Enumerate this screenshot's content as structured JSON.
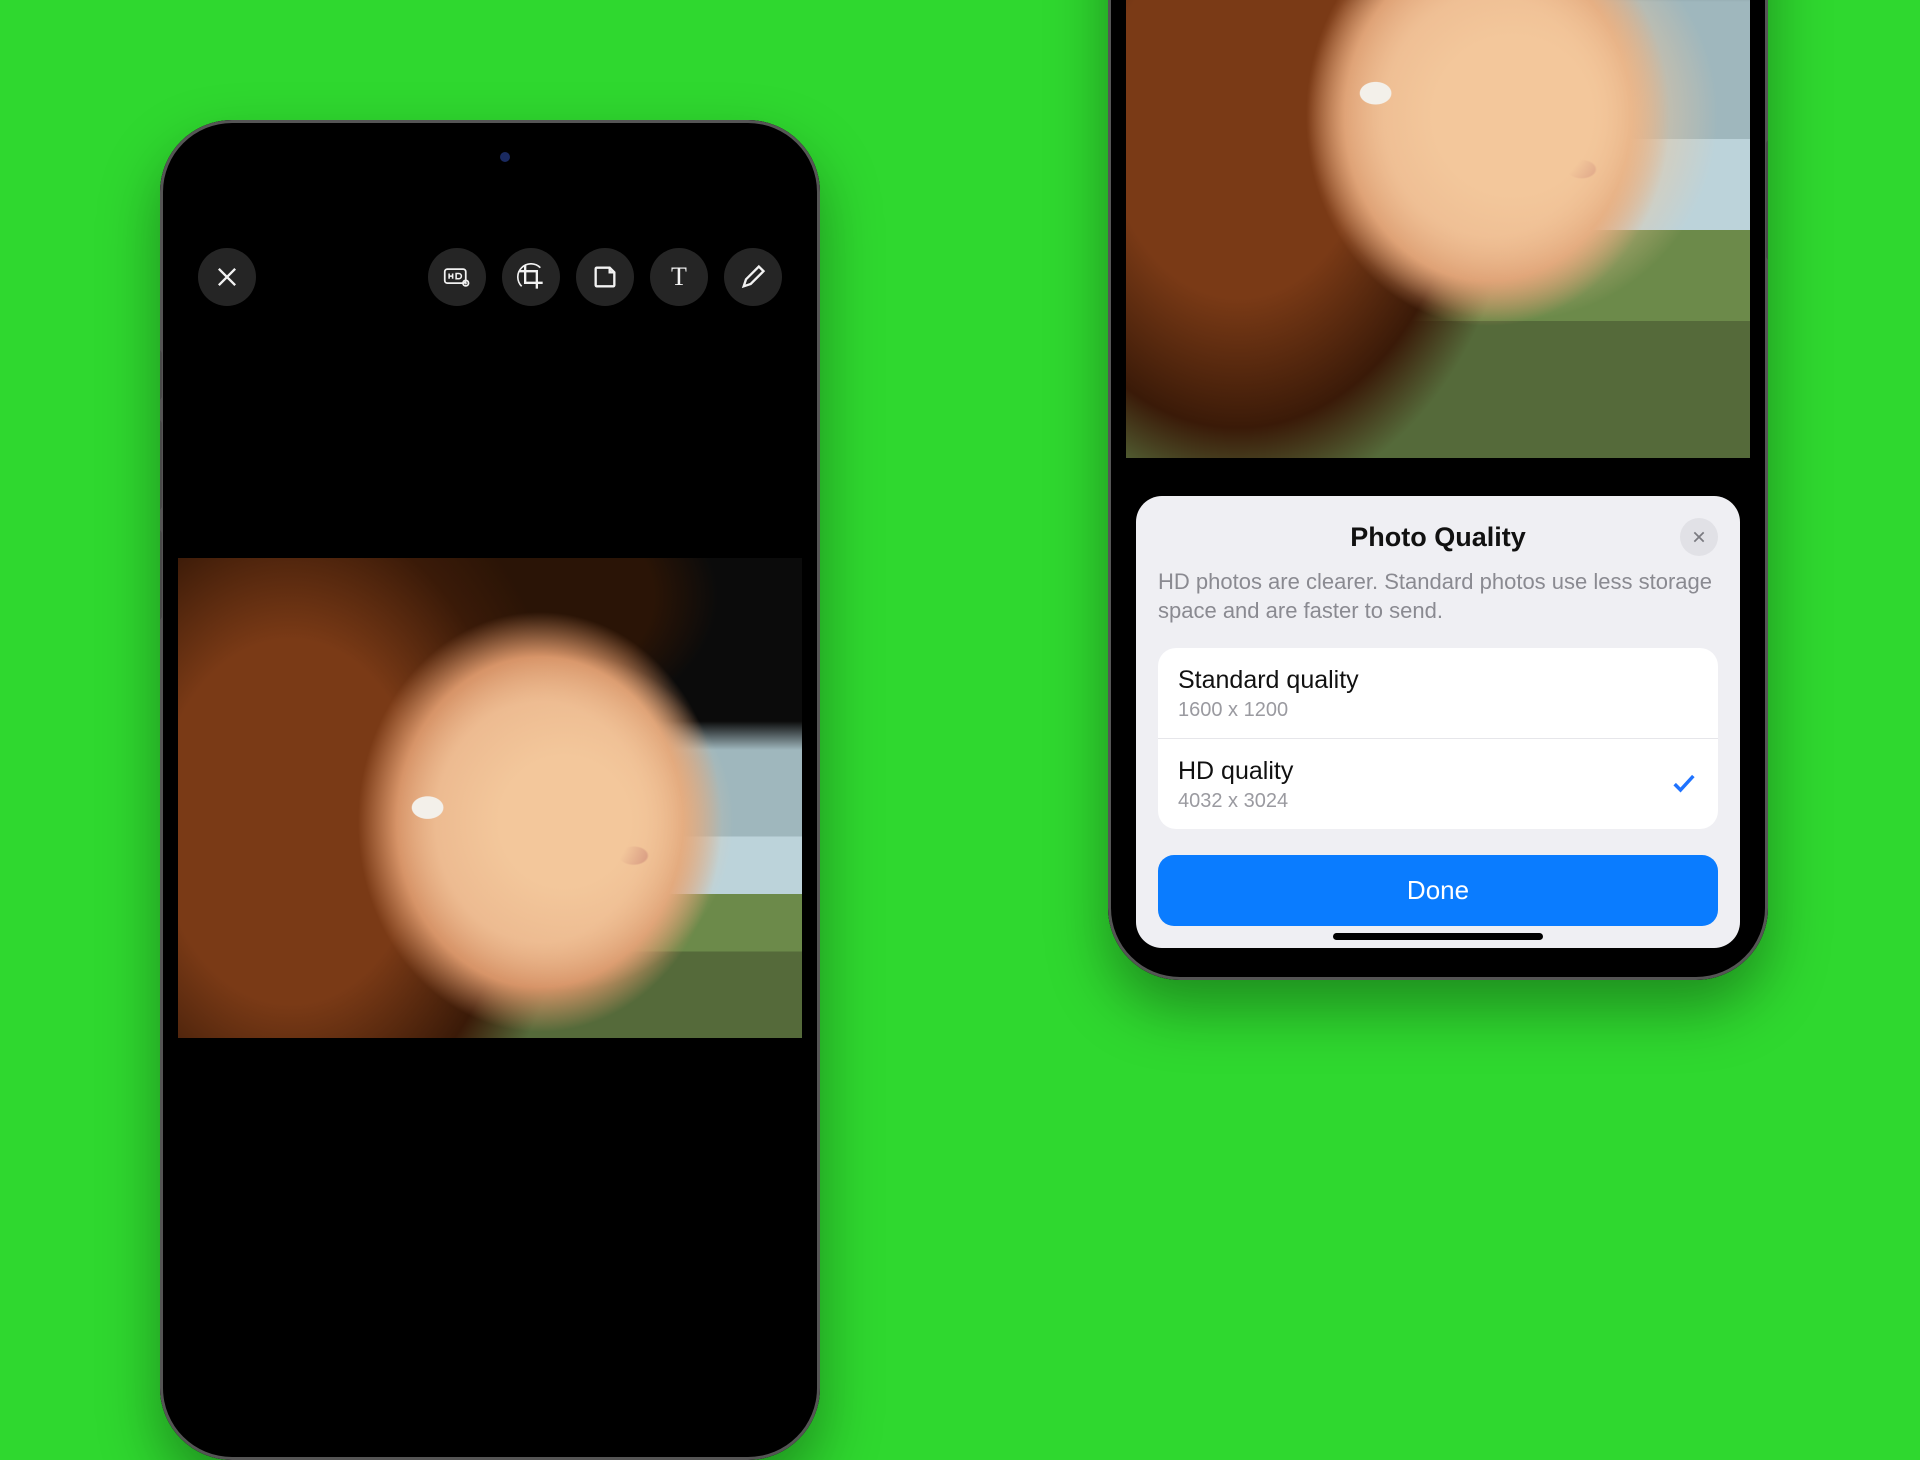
{
  "left_phone": {
    "toolbar": {
      "close": "close",
      "hd": "HD",
      "crop": "crop",
      "sticker": "sticker",
      "text": "T",
      "draw": "draw"
    }
  },
  "sheet": {
    "title": "Photo Quality",
    "description": "HD photos are clearer. Standard photos use less storage space and are faster to send.",
    "options": [
      {
        "name": "Standard quality",
        "resolution": "1600 x 1200",
        "selected": false
      },
      {
        "name": "HD quality",
        "resolution": "4032 x 3024",
        "selected": true
      }
    ],
    "done": "Done"
  }
}
